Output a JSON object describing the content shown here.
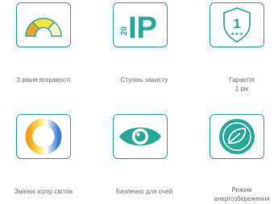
{
  "colors": {
    "teal": "#26a99b",
    "label_gray": "#6b6b6b",
    "gauge_orange": "#f2a12b",
    "gauge_yellow": "#f6e23a",
    "gauge_light": "#fbf7c8"
  },
  "features": [
    {
      "icon": "brightness-gauge-icon",
      "label": "3 рівня яскравості"
    },
    {
      "icon": "ip20-icon",
      "label": "Ступінь захисту",
      "ip_number": "20",
      "ip_text": "IP"
    },
    {
      "icon": "warranty-shield-icon",
      "label": "Гарантія\n1 рік",
      "badge_number": "1",
      "badge_stars": "★★★"
    },
    {
      "icon": "color-temperature-ring-icon",
      "label": "Змінює колір світла"
    },
    {
      "icon": "eye-icon",
      "label": "Безпечно для очей"
    },
    {
      "icon": "leaf-eco-icon",
      "label": "Режим\nенергозбереження"
    }
  ]
}
